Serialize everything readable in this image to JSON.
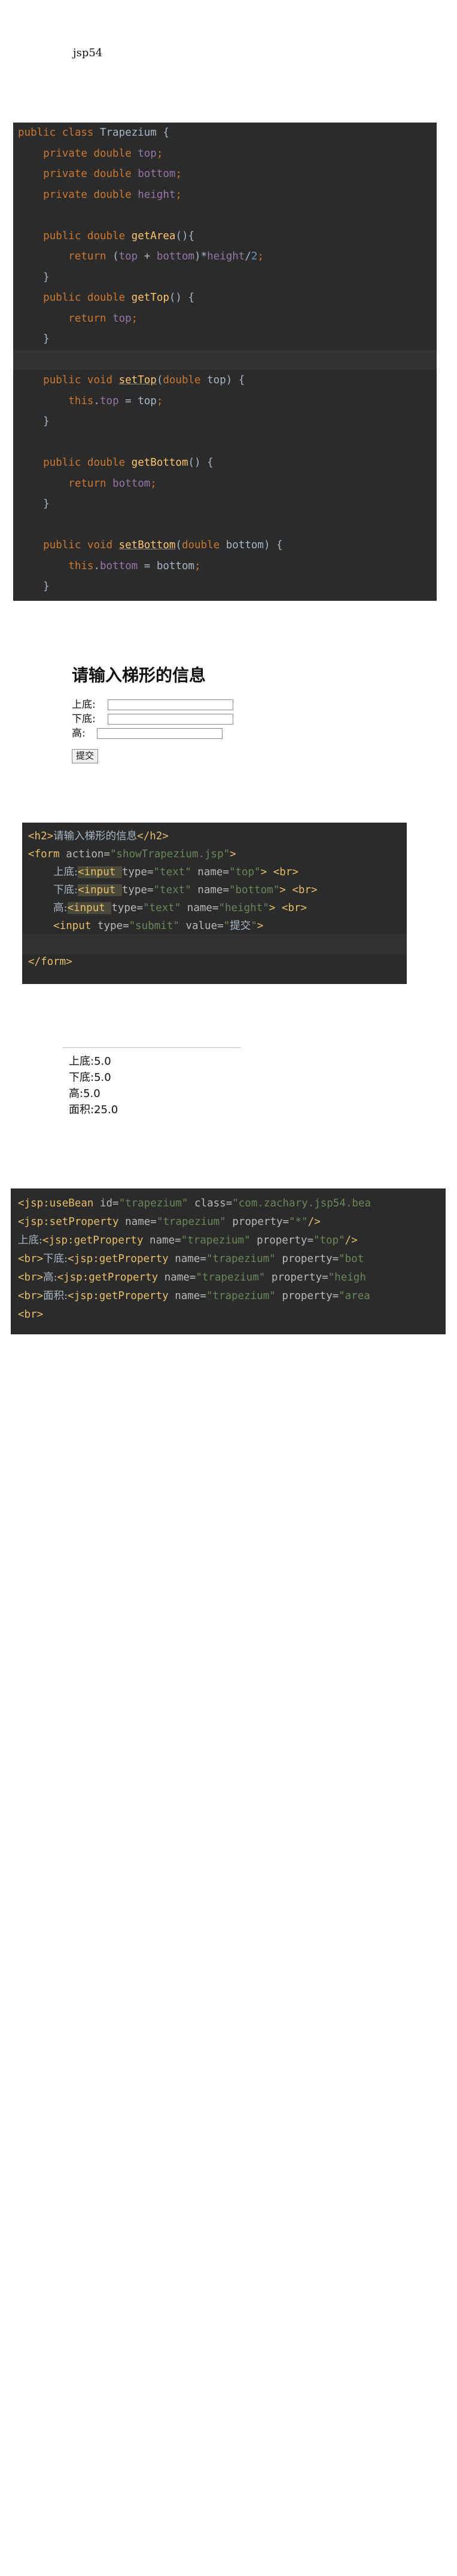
{
  "title": "jsp54",
  "java_code": [
    [
      [
        "k",
        "public class "
      ],
      [
        "p",
        "Trapezium {"
      ]
    ],
    [
      [
        "p",
        "    "
      ],
      [
        "k",
        "private double "
      ],
      [
        "f",
        "top"
      ],
      [
        "k",
        ";"
      ]
    ],
    [
      [
        "p",
        "    "
      ],
      [
        "k",
        "private double "
      ],
      [
        "f",
        "bottom"
      ],
      [
        "k",
        ";"
      ]
    ],
    [
      [
        "p",
        "    "
      ],
      [
        "k",
        "private double "
      ],
      [
        "f",
        "height"
      ],
      [
        "k",
        ";"
      ]
    ],
    [],
    [
      [
        "p",
        "    "
      ],
      [
        "k",
        "public double "
      ],
      [
        "m",
        "getArea"
      ],
      [
        "p",
        "(){"
      ]
    ],
    [
      [
        "p",
        "        "
      ],
      [
        "k",
        "return "
      ],
      [
        "p",
        "("
      ],
      [
        "f",
        "top"
      ],
      [
        "p",
        " + "
      ],
      [
        "f",
        "bottom"
      ],
      [
        "p",
        ")*"
      ],
      [
        "f",
        "height"
      ],
      [
        "p",
        "/"
      ],
      [
        "n",
        "2"
      ],
      [
        "k",
        ";"
      ]
    ],
    [
      [
        "p",
        "    }"
      ]
    ],
    [
      [
        "p",
        "    "
      ],
      [
        "k",
        "public double "
      ],
      [
        "m",
        "getTop"
      ],
      [
        "p",
        "() {"
      ]
    ],
    [
      [
        "p",
        "        "
      ],
      [
        "k",
        "return "
      ],
      [
        "f",
        "top"
      ],
      [
        "k",
        ";"
      ]
    ],
    [
      [
        "p",
        "    }"
      ]
    ],
    [],
    [
      [
        "p",
        "    "
      ],
      [
        "k",
        "public void "
      ],
      [
        "mu",
        "setTop"
      ],
      [
        "p",
        "("
      ],
      [
        "k",
        "double "
      ],
      [
        "p",
        "top) {"
      ]
    ],
    [
      [
        "p",
        "        "
      ],
      [
        "k",
        "this"
      ],
      [
        "p",
        "."
      ],
      [
        "f",
        "top"
      ],
      [
        "p",
        " = top"
      ],
      [
        "k",
        ";"
      ]
    ],
    [
      [
        "p",
        "    }"
      ]
    ],
    [],
    [
      [
        "p",
        "    "
      ],
      [
        "k",
        "public double "
      ],
      [
        "m",
        "getBottom"
      ],
      [
        "p",
        "() {"
      ]
    ],
    [
      [
        "p",
        "        "
      ],
      [
        "k",
        "return "
      ],
      [
        "f",
        "bottom"
      ],
      [
        "k",
        ";"
      ]
    ],
    [
      [
        "p",
        "    }"
      ]
    ],
    [],
    [
      [
        "p",
        "    "
      ],
      [
        "k",
        "public void "
      ],
      [
        "mu",
        "setBottom"
      ],
      [
        "p",
        "("
      ],
      [
        "k",
        "double "
      ],
      [
        "p",
        "bottom) {"
      ]
    ],
    [
      [
        "p",
        "        "
      ],
      [
        "k",
        "this"
      ],
      [
        "p",
        "."
      ],
      [
        "f",
        "bottom"
      ],
      [
        "p",
        " = bottom"
      ],
      [
        "k",
        ";"
      ]
    ],
    [
      [
        "p",
        "    }"
      ]
    ]
  ],
  "form": {
    "heading": "请输入梯形的信息",
    "fields": [
      {
        "label": "上底:"
      },
      {
        "label": "下底:"
      },
      {
        "label": "高:"
      }
    ],
    "submit_label": "提交"
  },
  "form_code": [
    [
      [
        "t",
        "<h2>"
      ],
      [
        "z",
        "请输入梯形的信息"
      ],
      [
        "t",
        "</h2>"
      ]
    ],
    [
      [
        "t",
        "<form "
      ],
      [
        "a",
        "action="
      ],
      [
        "s",
        "\"showTrapezium.jsp\""
      ],
      [
        "t",
        ">"
      ]
    ],
    [
      [
        "p",
        "    "
      ],
      [
        "z",
        "上底:"
      ],
      [
        "th",
        "<input "
      ],
      [
        "a",
        "type="
      ],
      [
        "s",
        "\"text\" "
      ],
      [
        "a",
        "name="
      ],
      [
        "s",
        "\"top\""
      ],
      [
        "t",
        "> <br>"
      ]
    ],
    [
      [
        "p",
        "    "
      ],
      [
        "z",
        "下底:"
      ],
      [
        "th",
        "<input "
      ],
      [
        "a",
        "type="
      ],
      [
        "s",
        "\"text\" "
      ],
      [
        "a",
        "name="
      ],
      [
        "s",
        "\"bottom\""
      ],
      [
        "t",
        "> <br>"
      ]
    ],
    [
      [
        "p",
        "    "
      ],
      [
        "z",
        "高:"
      ],
      [
        "th",
        "<input "
      ],
      [
        "a",
        "type="
      ],
      [
        "s",
        "\"text\" "
      ],
      [
        "a",
        "name="
      ],
      [
        "s",
        "\"height\""
      ],
      [
        "t",
        "> <br>"
      ]
    ],
    [
      [
        "p",
        "    "
      ],
      [
        "t",
        "<input "
      ],
      [
        "a",
        "type="
      ],
      [
        "s",
        "\"submit\" "
      ],
      [
        "a",
        "value="
      ],
      [
        "s",
        "\""
      ],
      [
        "z",
        "提交"
      ],
      [
        "s",
        "\""
      ],
      [
        "t",
        ">"
      ]
    ],
    [],
    [
      [
        "t",
        "</form>"
      ]
    ]
  ],
  "result_lines": [
    "上底:5.0",
    "下底:5.0",
    "高:5.0",
    "面积:25.0"
  ],
  "jsp_code": [
    [
      [
        "t",
        "<jsp:useBean "
      ],
      [
        "a",
        "id="
      ],
      [
        "s",
        "\"trapezium\" "
      ],
      [
        "a",
        "class="
      ],
      [
        "s",
        "\"com.zachary.jsp54.bea"
      ]
    ],
    [
      [
        "t",
        "<jsp:setProperty "
      ],
      [
        "a",
        "name="
      ],
      [
        "s",
        "\"trapezium\" "
      ],
      [
        "a",
        "property="
      ],
      [
        "s",
        "\"*\""
      ],
      [
        "t",
        "/>"
      ]
    ],
    [
      [
        "z",
        "上底:"
      ],
      [
        "t",
        "<jsp:getProperty "
      ],
      [
        "a",
        "name="
      ],
      [
        "s",
        "\"trapezium\" "
      ],
      [
        "a",
        "property="
      ],
      [
        "s",
        "\"top\""
      ],
      [
        "t",
        "/>"
      ]
    ],
    [
      [
        "t",
        "<br>"
      ],
      [
        "z",
        "下底:"
      ],
      [
        "t",
        "<jsp:getProperty "
      ],
      [
        "a",
        "name="
      ],
      [
        "s",
        "\"trapezium\" "
      ],
      [
        "a",
        "property="
      ],
      [
        "s",
        "\"bot"
      ]
    ],
    [
      [
        "t",
        "<br>"
      ],
      [
        "z",
        "高:"
      ],
      [
        "t",
        "<jsp:getProperty "
      ],
      [
        "a",
        "name="
      ],
      [
        "s",
        "\"trapezium\" "
      ],
      [
        "a",
        "property="
      ],
      [
        "s",
        "\"heigh"
      ]
    ],
    [
      [
        "t",
        "<br>"
      ],
      [
        "z",
        "面积:"
      ],
      [
        "t",
        "<jsp:getProperty "
      ],
      [
        "a",
        "name="
      ],
      [
        "s",
        "\"trapezium\" "
      ],
      [
        "a",
        "property="
      ],
      [
        "s",
        "\"area"
      ]
    ],
    [
      [
        "t",
        "<br>"
      ]
    ]
  ]
}
